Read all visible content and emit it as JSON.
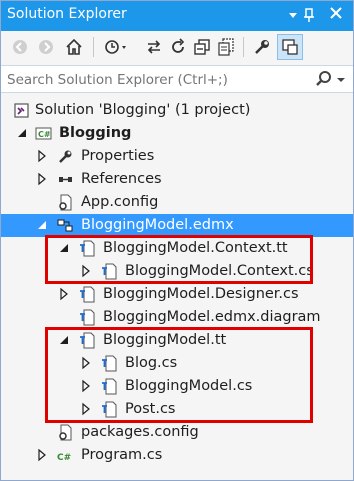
{
  "window": {
    "title": "Solution Explorer"
  },
  "toolbar": {
    "buttons": [
      "back-icon",
      "forward-icon",
      "home-icon",
      "history-icon",
      "sync-icon",
      "refresh-icon",
      "collapse-all-icon",
      "show-all-files-icon",
      "properties-icon",
      "preview-icon"
    ]
  },
  "search": {
    "placeholder": "Search Solution Explorer (Ctrl+;)"
  },
  "tree": {
    "solution": "Solution 'Blogging' (1 project)",
    "project": "Blogging",
    "properties": "Properties",
    "references": "References",
    "app_config": "App.config",
    "edmx": "BloggingModel.edmx",
    "context_tt": "BloggingModel.Context.tt",
    "context_cs": "BloggingModel.Context.cs",
    "designer_cs": "BloggingModel.Designer.cs",
    "edmx_diagram": "BloggingModel.edmx.diagram",
    "model_tt": "BloggingModel.tt",
    "blog_cs": "Blog.cs",
    "model_cs": "BloggingModel.cs",
    "post_cs": "Post.cs",
    "packages_config": "packages.config",
    "program_cs": "Program.cs"
  },
  "colors": {
    "title_bar": "#1c97ea",
    "selection": "#3399ff",
    "highlight_box": "#e00000"
  }
}
